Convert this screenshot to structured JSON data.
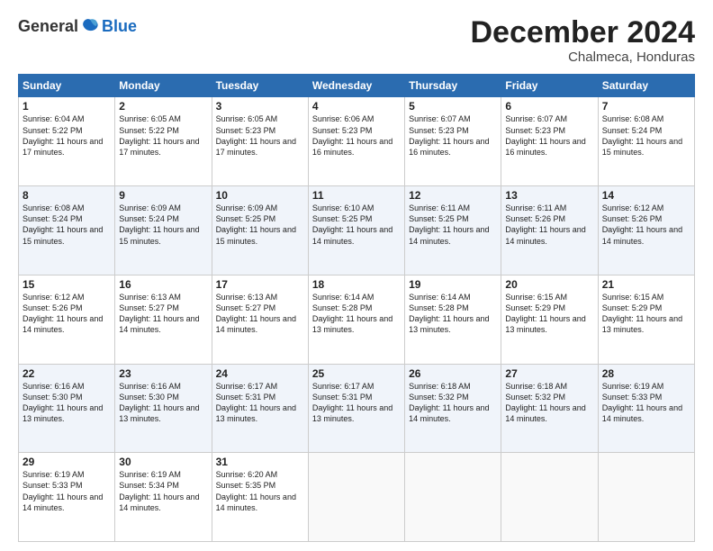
{
  "logo": {
    "general": "General",
    "blue": "Blue"
  },
  "title": "December 2024",
  "location": "Chalmeca, Honduras",
  "days_of_week": [
    "Sunday",
    "Monday",
    "Tuesday",
    "Wednesday",
    "Thursday",
    "Friday",
    "Saturday"
  ],
  "weeks": [
    [
      {
        "day": "1",
        "sunrise": "6:04 AM",
        "sunset": "5:22 PM",
        "daylight": "11 hours and 17 minutes."
      },
      {
        "day": "2",
        "sunrise": "6:05 AM",
        "sunset": "5:22 PM",
        "daylight": "11 hours and 17 minutes."
      },
      {
        "day": "3",
        "sunrise": "6:05 AM",
        "sunset": "5:23 PM",
        "daylight": "11 hours and 17 minutes."
      },
      {
        "day": "4",
        "sunrise": "6:06 AM",
        "sunset": "5:23 PM",
        "daylight": "11 hours and 16 minutes."
      },
      {
        "day": "5",
        "sunrise": "6:07 AM",
        "sunset": "5:23 PM",
        "daylight": "11 hours and 16 minutes."
      },
      {
        "day": "6",
        "sunrise": "6:07 AM",
        "sunset": "5:23 PM",
        "daylight": "11 hours and 16 minutes."
      },
      {
        "day": "7",
        "sunrise": "6:08 AM",
        "sunset": "5:24 PM",
        "daylight": "11 hours and 15 minutes."
      }
    ],
    [
      {
        "day": "8",
        "sunrise": "6:08 AM",
        "sunset": "5:24 PM",
        "daylight": "11 hours and 15 minutes."
      },
      {
        "day": "9",
        "sunrise": "6:09 AM",
        "sunset": "5:24 PM",
        "daylight": "11 hours and 15 minutes."
      },
      {
        "day": "10",
        "sunrise": "6:09 AM",
        "sunset": "5:25 PM",
        "daylight": "11 hours and 15 minutes."
      },
      {
        "day": "11",
        "sunrise": "6:10 AM",
        "sunset": "5:25 PM",
        "daylight": "11 hours and 14 minutes."
      },
      {
        "day": "12",
        "sunrise": "6:11 AM",
        "sunset": "5:25 PM",
        "daylight": "11 hours and 14 minutes."
      },
      {
        "day": "13",
        "sunrise": "6:11 AM",
        "sunset": "5:26 PM",
        "daylight": "11 hours and 14 minutes."
      },
      {
        "day": "14",
        "sunrise": "6:12 AM",
        "sunset": "5:26 PM",
        "daylight": "11 hours and 14 minutes."
      }
    ],
    [
      {
        "day": "15",
        "sunrise": "6:12 AM",
        "sunset": "5:26 PM",
        "daylight": "11 hours and 14 minutes."
      },
      {
        "day": "16",
        "sunrise": "6:13 AM",
        "sunset": "5:27 PM",
        "daylight": "11 hours and 14 minutes."
      },
      {
        "day": "17",
        "sunrise": "6:13 AM",
        "sunset": "5:27 PM",
        "daylight": "11 hours and 14 minutes."
      },
      {
        "day": "18",
        "sunrise": "6:14 AM",
        "sunset": "5:28 PM",
        "daylight": "11 hours and 13 minutes."
      },
      {
        "day": "19",
        "sunrise": "6:14 AM",
        "sunset": "5:28 PM",
        "daylight": "11 hours and 13 minutes."
      },
      {
        "day": "20",
        "sunrise": "6:15 AM",
        "sunset": "5:29 PM",
        "daylight": "11 hours and 13 minutes."
      },
      {
        "day": "21",
        "sunrise": "6:15 AM",
        "sunset": "5:29 PM",
        "daylight": "11 hours and 13 minutes."
      }
    ],
    [
      {
        "day": "22",
        "sunrise": "6:16 AM",
        "sunset": "5:30 PM",
        "daylight": "11 hours and 13 minutes."
      },
      {
        "day": "23",
        "sunrise": "6:16 AM",
        "sunset": "5:30 PM",
        "daylight": "11 hours and 13 minutes."
      },
      {
        "day": "24",
        "sunrise": "6:17 AM",
        "sunset": "5:31 PM",
        "daylight": "11 hours and 13 minutes."
      },
      {
        "day": "25",
        "sunrise": "6:17 AM",
        "sunset": "5:31 PM",
        "daylight": "11 hours and 13 minutes."
      },
      {
        "day": "26",
        "sunrise": "6:18 AM",
        "sunset": "5:32 PM",
        "daylight": "11 hours and 14 minutes."
      },
      {
        "day": "27",
        "sunrise": "6:18 AM",
        "sunset": "5:32 PM",
        "daylight": "11 hours and 14 minutes."
      },
      {
        "day": "28",
        "sunrise": "6:19 AM",
        "sunset": "5:33 PM",
        "daylight": "11 hours and 14 minutes."
      }
    ],
    [
      {
        "day": "29",
        "sunrise": "6:19 AM",
        "sunset": "5:33 PM",
        "daylight": "11 hours and 14 minutes."
      },
      {
        "day": "30",
        "sunrise": "6:19 AM",
        "sunset": "5:34 PM",
        "daylight": "11 hours and 14 minutes."
      },
      {
        "day": "31",
        "sunrise": "6:20 AM",
        "sunset": "5:35 PM",
        "daylight": "11 hours and 14 minutes."
      },
      null,
      null,
      null,
      null
    ]
  ]
}
